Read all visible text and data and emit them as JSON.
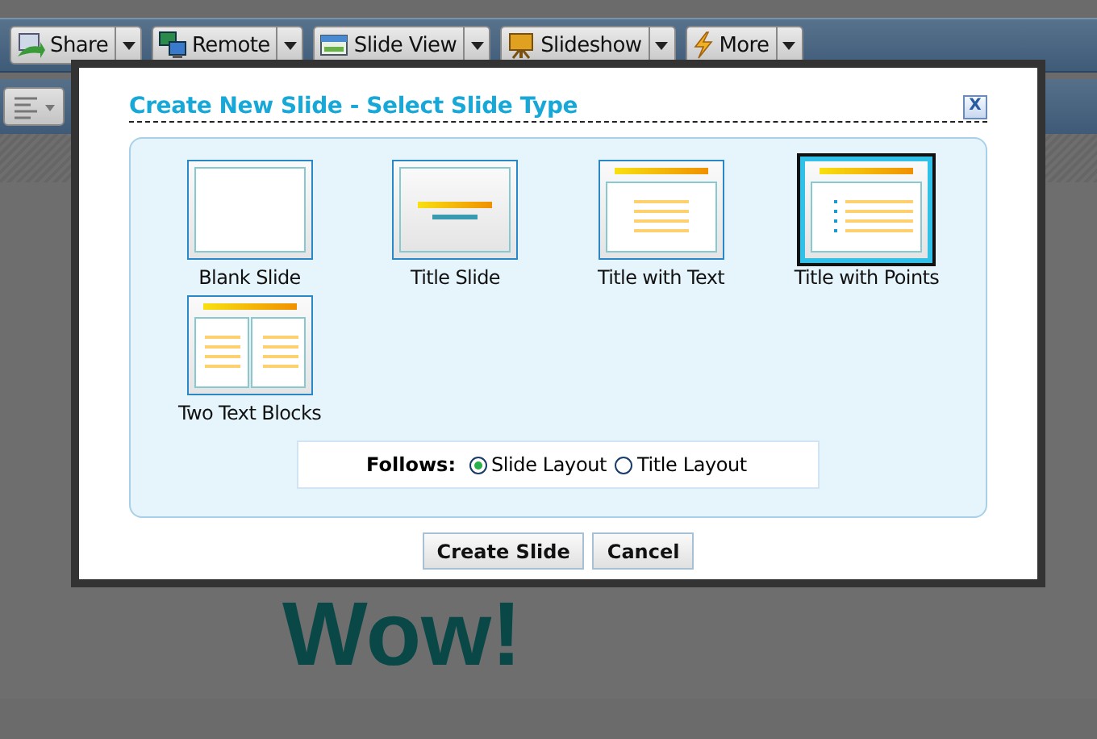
{
  "toolbar": [
    {
      "label": "Share"
    },
    {
      "label": "Remote"
    },
    {
      "label": "Slide View"
    },
    {
      "label": "Slideshow"
    },
    {
      "label": "More"
    }
  ],
  "slide_text": "Wow!",
  "dialog": {
    "title": "Create New Slide - Select Slide Type",
    "close": "X",
    "slide_types": [
      {
        "label": "Blank Slide",
        "kind": "blank",
        "selected": false
      },
      {
        "label": "Title Slide",
        "kind": "title",
        "selected": false
      },
      {
        "label": "Title with Text",
        "kind": "text",
        "selected": false
      },
      {
        "label": "Title with Points",
        "kind": "points",
        "selected": true
      },
      {
        "label": "Two Text Blocks",
        "kind": "two",
        "selected": false
      }
    ],
    "follows": {
      "label": "Follows:",
      "options": [
        {
          "label": "Slide Layout",
          "selected": true
        },
        {
          "label": "Title Layout",
          "selected": false
        }
      ]
    },
    "buttons": [
      "Create Slide",
      "Cancel"
    ]
  }
}
